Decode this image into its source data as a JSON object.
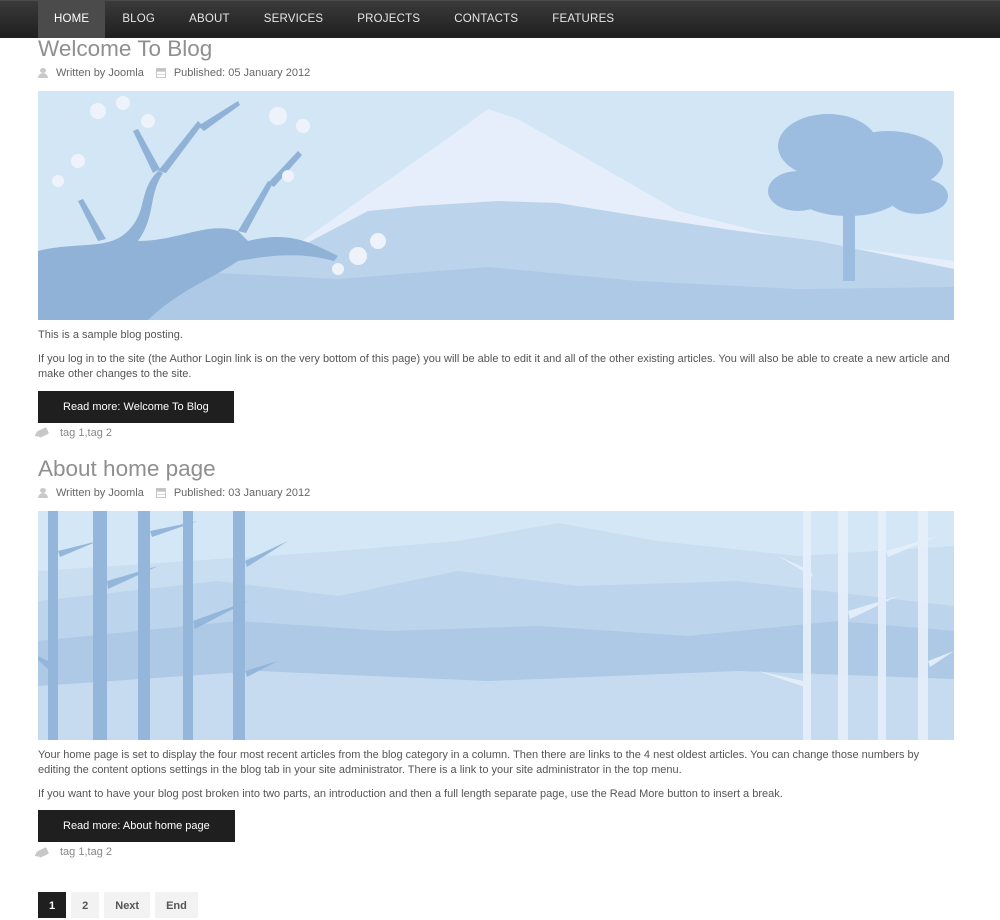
{
  "nav": {
    "items": [
      {
        "label": "HOME",
        "active": true
      },
      {
        "label": "BLOG"
      },
      {
        "label": "ABOUT"
      },
      {
        "label": "SERVICES"
      },
      {
        "label": "PROJECTS"
      },
      {
        "label": "CONTACTS"
      },
      {
        "label": "FEATURES"
      }
    ]
  },
  "articles": [
    {
      "title": "Welcome To Blog",
      "author": "Written by Joomla",
      "published": "Published: 05 January 2012",
      "paragraphs": [
        "This is a sample blog posting.",
        "If you log in to the site (the Author Login link is on the very bottom of this page) you will be able to edit it and all of the other existing articles. You will also be able to create a new article and make other changes to the site."
      ],
      "read_more": "Read more: Welcome To Blog",
      "tags": [
        "tag 1",
        "tag 2"
      ]
    },
    {
      "title": "About home page",
      "author": "Written by Joomla",
      "published": "Published: 03 January 2012",
      "paragraphs": [
        "Your home page is set to display the four most recent articles from the blog category in a column. Then there are links to the 4 nest oldest articles. You can change those numbers by editing the content options settings in the blog tab in your site administrator. There is a link to your site administrator in the top menu.",
        "If you want to have your blog post broken into two parts, an introduction and then a full length separate page, use the Read More button to insert a break."
      ],
      "read_more": "Read more: About home page",
      "tags": [
        "tag 1",
        "tag 2"
      ]
    }
  ],
  "tag_separator": " , ",
  "pagination": {
    "pages": [
      "1",
      "2"
    ],
    "current": "1",
    "next": "Next",
    "end": "End"
  },
  "colors": {
    "topbar": "#262626",
    "button": "#1f1f1f",
    "title": "#8f8f8f",
    "sky": "#cfe4f5",
    "mountain": "#b9d3ec"
  }
}
